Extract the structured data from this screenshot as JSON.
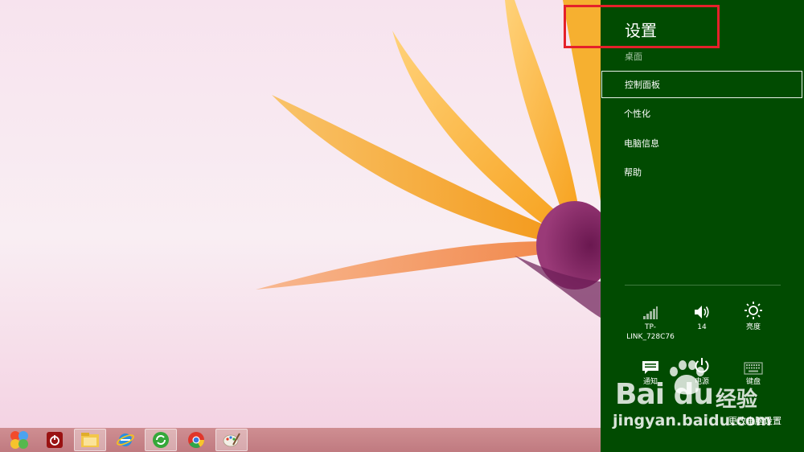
{
  "settings_pane": {
    "title": "设置",
    "subtitle": "桌面",
    "menu_items": [
      {
        "label": "控制面板"
      },
      {
        "label": "个性化"
      },
      {
        "label": "电脑信息"
      },
      {
        "label": "帮助"
      }
    ],
    "quick_settings": [
      {
        "icon": "wifi-signal-icon",
        "label": "TP-LINK_728C76"
      },
      {
        "icon": "volume-icon",
        "label": "14"
      },
      {
        "icon": "brightness-icon",
        "label": "亮度"
      },
      {
        "icon": "notifications-icon",
        "label": "通知"
      },
      {
        "icon": "power-icon",
        "label": "电源"
      },
      {
        "icon": "keyboard-icon",
        "label": "键盘"
      }
    ],
    "footer_link": "更改电脑设置",
    "background_color": "#014b01"
  },
  "taskbar": {
    "apps": [
      {
        "icon": "start-orb-icon"
      },
      {
        "icon": "shutdown-app-icon"
      },
      {
        "icon": "file-explorer-icon"
      },
      {
        "icon": "internet-explorer-icon"
      },
      {
        "icon": "green-refresh-app-icon"
      },
      {
        "icon": "chrome-icon"
      },
      {
        "icon": "paint-icon"
      }
    ]
  },
  "watermark": {
    "brand": "Bai du",
    "product": "经验",
    "url": "jingyan.baidu.com"
  },
  "highlight_color": "#e5202a"
}
